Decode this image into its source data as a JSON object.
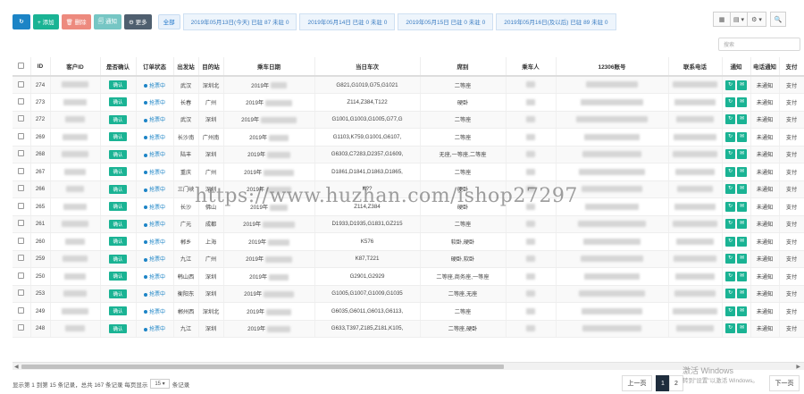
{
  "toolbar": {
    "refresh_icon": "↻",
    "add_label": "+ 添加",
    "delete_label": "🗑 删除",
    "notify_label": "🗐 通知",
    "more_label": "⚙ 更多",
    "all_label": "全部",
    "date_filters": [
      "2019年05月13日(今天) 已驻 87 未驻 0",
      "2019年05月14日 已驻 0 未驻 0",
      "2019年05月15日 已驻 0 未驻 0",
      "2019年05月16日(及以后) 已驻 89 未驻 0"
    ],
    "right_icons": [
      "▦",
      "▤ ▾",
      "⚙ ▾",
      "🔍"
    ]
  },
  "search": {
    "placeholder": "搜索"
  },
  "table": {
    "headers": [
      "",
      "ID",
      "客户ID",
      "是否确认",
      "订单状态",
      "出发站",
      "目的站",
      "乘车日期",
      "当日车次",
      "席别",
      "乘车人",
      "12306账号",
      "联系电话",
      "通知",
      "电话通知",
      "支付"
    ],
    "confirm_label": "确认",
    "status_label": "抢票中",
    "notify_text": "未通知",
    "pay_text": "支付",
    "rows": [
      {
        "id": "274",
        "from": "武汉",
        "to": "深圳北",
        "date": "2019年",
        "train": "G821,G1019,G75,G1021",
        "seat": "二等座"
      },
      {
        "id": "273",
        "from": "长春",
        "to": "广州",
        "date": "2019年",
        "train": "Z114,Z384,T122",
        "seat": "硬卧"
      },
      {
        "id": "272",
        "from": "武汉",
        "to": "深圳",
        "date": "2019年",
        "train": "G1001,G1003,G1005,G77,G",
        "seat": "二等座"
      },
      {
        "id": "269",
        "from": "长沙南",
        "to": "广州南",
        "date": "2019年",
        "train": "G1103,K759,G1001,G6107,",
        "seat": "二等座"
      },
      {
        "id": "268",
        "from": "陆丰",
        "to": "深圳",
        "date": "2019年",
        "train": "G6303,C7283,D2357,G1609,",
        "seat": "无座,一等座,二等座"
      },
      {
        "id": "267",
        "from": "重庆",
        "to": "广州",
        "date": "2019年",
        "train": "D1861,D1841,D1863,D1865,",
        "seat": "二等座"
      },
      {
        "id": "266",
        "from": "三门峡",
        "to": "深圳",
        "date": "2019年",
        "train": "K??",
        "seat": "硬卧"
      },
      {
        "id": "265",
        "from": "长沙",
        "to": "佛山",
        "date": "2019年",
        "train": "Z114,Z384",
        "seat": "硬卧"
      },
      {
        "id": "261",
        "from": "广元",
        "to": "成都",
        "date": "2019年",
        "train": "D1933,D1935,G1831,GZ215",
        "seat": "二等座"
      },
      {
        "id": "260",
        "from": "郴乡",
        "to": "上海",
        "date": "2019年",
        "train": "K576",
        "seat": "软卧,硬卧"
      },
      {
        "id": "259",
        "from": "九江",
        "to": "广州",
        "date": "2019年",
        "train": "K87,T221",
        "seat": "硬卧,软卧"
      },
      {
        "id": "250",
        "from": "韩山西",
        "to": "深圳",
        "date": "2019年",
        "train": "G2901,G2929",
        "seat": "二等座,商务座,一等座"
      },
      {
        "id": "253",
        "from": "衡阳东",
        "to": "深圳",
        "date": "2019年",
        "train": "G1005,G1007,G1009,G1035",
        "seat": "二等座,无座"
      },
      {
        "id": "249",
        "from": "郴州西",
        "to": "深圳北",
        "date": "2019年",
        "train": "G6035,G6011,G6013,G6113,",
        "seat": "二等座"
      },
      {
        "id": "248",
        "from": "九江",
        "to": "深圳",
        "date": "2019年",
        "train": "G633,T397,Z185,Z181,K105,",
        "seat": "二等座,硬卧"
      }
    ]
  },
  "watermark": "https://www.huzhan.com/ishop27297",
  "footer": {
    "summary": "显示第 1 到第 15 条记录，总共 167 条记录 每页显示",
    "page_size": "15 ▾",
    "suffix": "条记录"
  },
  "pager": {
    "prev": "上一页",
    "pages": [
      "1",
      "2"
    ],
    "next": "下一页"
  },
  "windows_mark": {
    "line1": "激活 Windows",
    "line2": "转到\"设置\"以激活 Windows。"
  }
}
